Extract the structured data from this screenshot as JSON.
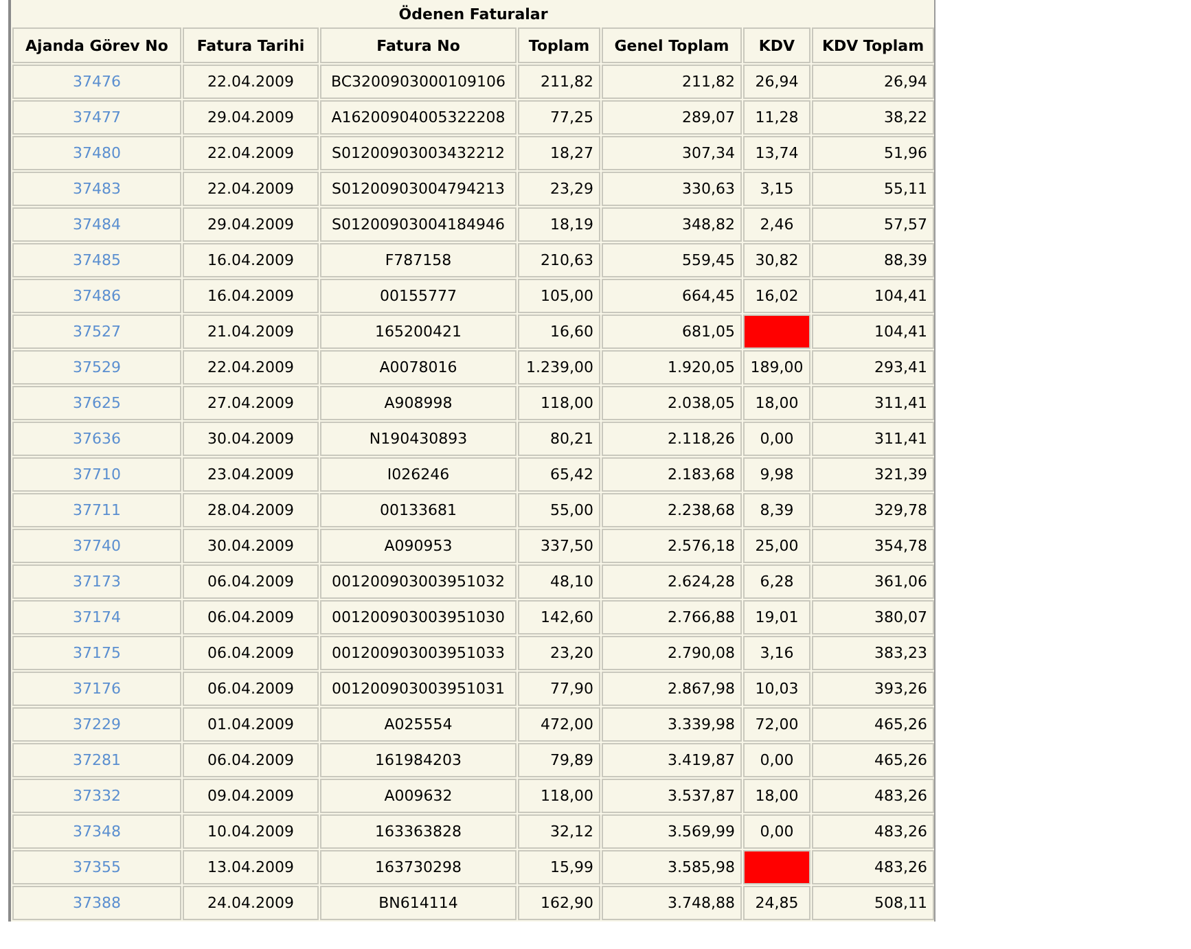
{
  "table": {
    "title": "Ödenen Faturalar",
    "columns": [
      "Ajanda Görev No",
      "Fatura Tarihi",
      "Fatura No",
      "Toplam",
      "Genel Toplam",
      "KDV",
      "KDV Toplam"
    ],
    "rows": [
      {
        "id": "37476",
        "date": "22.04.2009",
        "invoice": "BC3200903000109106",
        "total": "211,82",
        "grand_total": "211,82",
        "kdv": "26,94",
        "kdv_total": "26,94",
        "flagged": false
      },
      {
        "id": "37477",
        "date": "29.04.2009",
        "invoice": "A16200904005322208",
        "total": "77,25",
        "grand_total": "289,07",
        "kdv": "11,28",
        "kdv_total": "38,22",
        "flagged": false
      },
      {
        "id": "37480",
        "date": "22.04.2009",
        "invoice": "S01200903003432212",
        "total": "18,27",
        "grand_total": "307,34",
        "kdv": "13,74",
        "kdv_total": "51,96",
        "flagged": false
      },
      {
        "id": "37483",
        "date": "22.04.2009",
        "invoice": "S01200903004794213",
        "total": "23,29",
        "grand_total": "330,63",
        "kdv": "3,15",
        "kdv_total": "55,11",
        "flagged": false
      },
      {
        "id": "37484",
        "date": "29.04.2009",
        "invoice": "S01200903004184946",
        "total": "18,19",
        "grand_total": "348,82",
        "kdv": "2,46",
        "kdv_total": "57,57",
        "flagged": false
      },
      {
        "id": "37485",
        "date": "16.04.2009",
        "invoice": "F787158",
        "total": "210,63",
        "grand_total": "559,45",
        "kdv": "30,82",
        "kdv_total": "88,39",
        "flagged": false
      },
      {
        "id": "37486",
        "date": "16.04.2009",
        "invoice": "00155777",
        "total": "105,00",
        "grand_total": "664,45",
        "kdv": "16,02",
        "kdv_total": "104,41",
        "flagged": false
      },
      {
        "id": "37527",
        "date": "21.04.2009",
        "invoice": "165200421",
        "total": "16,60",
        "grand_total": "681,05",
        "kdv_total": "104,41",
        "flagged": true
      },
      {
        "id": "37529",
        "date": "22.04.2009",
        "invoice": "A0078016",
        "total": "1.239,00",
        "grand_total": "1.920,05",
        "kdv": "189,00",
        "kdv_total": "293,41",
        "flagged": false
      },
      {
        "id": "37625",
        "date": "27.04.2009",
        "invoice": "A908998",
        "total": "118,00",
        "grand_total": "2.038,05",
        "kdv": "18,00",
        "kdv_total": "311,41",
        "flagged": false
      },
      {
        "id": "37636",
        "date": "30.04.2009",
        "invoice": "N190430893",
        "total": "80,21",
        "grand_total": "2.118,26",
        "kdv": "0,00",
        "kdv_total": "311,41",
        "flagged": false
      },
      {
        "id": "37710",
        "date": "23.04.2009",
        "invoice": "I026246",
        "total": "65,42",
        "grand_total": "2.183,68",
        "kdv": "9,98",
        "kdv_total": "321,39",
        "flagged": false
      },
      {
        "id": "37711",
        "date": "28.04.2009",
        "invoice": "00133681",
        "total": "55,00",
        "grand_total": "2.238,68",
        "kdv": "8,39",
        "kdv_total": "329,78",
        "flagged": false
      },
      {
        "id": "37740",
        "date": "30.04.2009",
        "invoice": "A090953",
        "total": "337,50",
        "grand_total": "2.576,18",
        "kdv": "25,00",
        "kdv_total": "354,78",
        "flagged": false
      },
      {
        "id": "37173",
        "date": "06.04.2009",
        "invoice": "001200903003951032",
        "total": "48,10",
        "grand_total": "2.624,28",
        "kdv": "6,28",
        "kdv_total": "361,06",
        "flagged": false
      },
      {
        "id": "37174",
        "date": "06.04.2009",
        "invoice": "001200903003951030",
        "total": "142,60",
        "grand_total": "2.766,88",
        "kdv": "19,01",
        "kdv_total": "380,07",
        "flagged": false
      },
      {
        "id": "37175",
        "date": "06.04.2009",
        "invoice": "001200903003951033",
        "total": "23,20",
        "grand_total": "2.790,08",
        "kdv": "3,16",
        "kdv_total": "383,23",
        "flagged": false
      },
      {
        "id": "37176",
        "date": "06.04.2009",
        "invoice": "001200903003951031",
        "total": "77,90",
        "grand_total": "2.867,98",
        "kdv": "10,03",
        "kdv_total": "393,26",
        "flagged": false
      },
      {
        "id": "37229",
        "date": "01.04.2009",
        "invoice": "A025554",
        "total": "472,00",
        "grand_total": "3.339,98",
        "kdv": "72,00",
        "kdv_total": "465,26",
        "flagged": false
      },
      {
        "id": "37281",
        "date": "06.04.2009",
        "invoice": "161984203",
        "total": "79,89",
        "grand_total": "3.419,87",
        "kdv": "0,00",
        "kdv_total": "465,26",
        "flagged": false
      },
      {
        "id": "37332",
        "date": "09.04.2009",
        "invoice": "A009632",
        "total": "118,00",
        "grand_total": "3.537,87",
        "kdv": "18,00",
        "kdv_total": "483,26",
        "flagged": false
      },
      {
        "id": "37348",
        "date": "10.04.2009",
        "invoice": "163363828",
        "total": "32,12",
        "grand_total": "3.569,99",
        "kdv": "0,00",
        "kdv_total": "483,26",
        "flagged": false
      },
      {
        "id": "37355",
        "date": "13.04.2009",
        "invoice": "163730298",
        "total": "15,99",
        "grand_total": "3.585,98",
        "kdv_total": "483,26",
        "flagged": true
      },
      {
        "id": "37388",
        "date": "24.04.2009",
        "invoice": "BN614114",
        "total": "162,90",
        "grand_total": "3.748,88",
        "kdv": "24,85",
        "kdv_total": "508,11",
        "flagged": false
      }
    ]
  }
}
